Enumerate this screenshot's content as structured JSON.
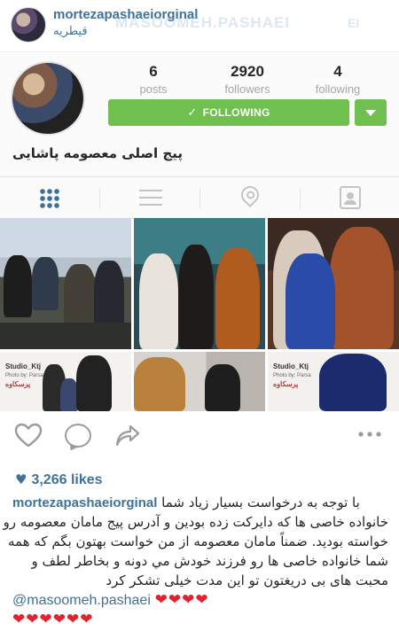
{
  "post": {
    "username": "mortezapashaeiorginal",
    "location": "قیطریه",
    "watermark": "MASOOMEH.PASHAEI",
    "watermark_suffix": "EI"
  },
  "profile": {
    "stats": [
      {
        "value": "6",
        "label": "posts"
      },
      {
        "value": "2920",
        "label": "followers"
      },
      {
        "value": "4",
        "label": "following"
      }
    ],
    "follow_button": "FOLLOWING",
    "bio": "پیج اصلی معصومه پاشایی"
  },
  "grid": {
    "stamp_title": "Studio_Ktj",
    "stamp_sub": "Photo by: Parsa",
    "stamp_brand": "پرسکاوه"
  },
  "likes": {
    "count": "3,266 likes"
  },
  "caption": {
    "username": "mortezapashaeiorginal",
    "first_line_text": "با توجه به درخواست بسیار زیاد شما",
    "lines": [
      "خانواده خاصی ها که دایرکت زده بودین و آدرس پیج مامان معصومه رو",
      "خواسته بودید. ضمناً مامان معصومه از من خواست بهتون بگم که همه",
      "شما خانواده خاصی ها رو فرزند خودش مي دونه و بخاطر لطف و",
      "محبت های بی دریغتون تو این مدت خیلی تشکر کرد"
    ],
    "mention": "@masoomeh.pashaei",
    "hearts_inline": "❤❤❤❤",
    "hearts_row": "❤❤❤❤❤❤"
  },
  "colors": {
    "link_blue": "#3f729b",
    "follow_green": "#70c050",
    "heart_red": "#e0242e"
  }
}
